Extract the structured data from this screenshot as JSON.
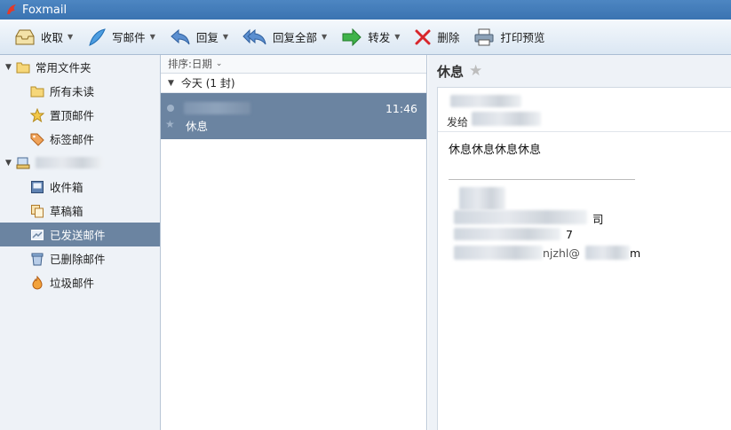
{
  "app": {
    "title": "Foxmail"
  },
  "toolbar": {
    "receive_label": "收取",
    "compose_label": "写邮件",
    "reply_label": "回复",
    "reply_all_label": "回复全部",
    "forward_label": "转发",
    "delete_label": "删除",
    "print_preview_label": "打印预览"
  },
  "sidebar": {
    "common_group_label": "常用文件夹",
    "common_items": [
      {
        "label": "所有未读",
        "icon": "folder-icon"
      },
      {
        "label": "置顶邮件",
        "icon": "star-icon"
      },
      {
        "label": "标签邮件",
        "icon": "tag-icon"
      }
    ],
    "account_items": [
      {
        "label": "收件箱",
        "icon": "inbox-icon"
      },
      {
        "label": "草稿箱",
        "icon": "drafts-icon"
      },
      {
        "label": "已发送邮件",
        "icon": "sent-icon"
      },
      {
        "label": "已删除邮件",
        "icon": "trash-icon"
      },
      {
        "label": "垃圾邮件",
        "icon": "spam-icon"
      }
    ]
  },
  "list": {
    "sort_label": "排序:日期",
    "group_header": "今天 (1 封)",
    "messages": [
      {
        "time": "11:46",
        "subject": "休息"
      }
    ]
  },
  "reader": {
    "subject": "休息",
    "to_label": "发给",
    "body": "休息休息休息休息",
    "signature": {
      "line2_tail": "司",
      "line3_tail": "7",
      "line4_tail": "njzhl@",
      "line4_end": "m"
    }
  },
  "colors": {
    "accent": "#6b84a1",
    "titlebar": "#3f78b6"
  }
}
